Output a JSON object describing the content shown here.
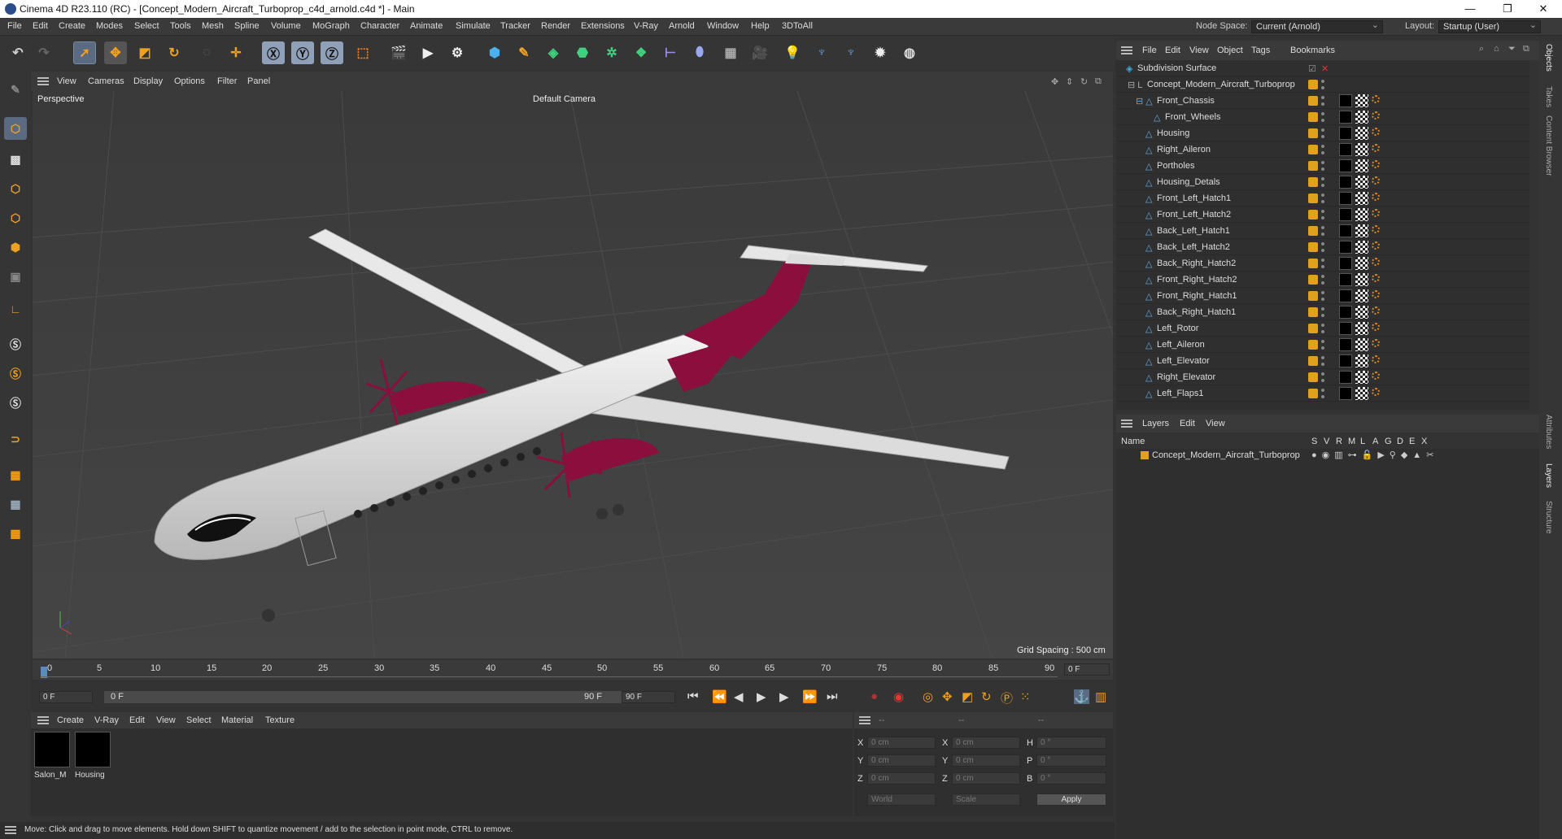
{
  "window": {
    "title": "Cinema 4D R23.110 (RC) - [Concept_Modern_Aircraft_Turboprop_c4d_arnold.c4d *] - Main",
    "controls": [
      "—",
      "❐",
      "✕"
    ]
  },
  "menubar": {
    "items": [
      "File",
      "Edit",
      "Create",
      "Modes",
      "Select",
      "Tools",
      "Mesh",
      "Spline",
      "Volume",
      "MoGraph",
      "Character",
      "Animate",
      "Simulate",
      "Tracker",
      "Render",
      "Extensions",
      "V-Ray",
      "Arnold",
      "Window",
      "Help",
      "3DToAll"
    ],
    "node_space_label": "Node Space:",
    "node_space_value": "Current (Arnold)",
    "layout_label": "Layout:",
    "layout_value": "Startup (User)"
  },
  "viewport": {
    "menu": [
      "View",
      "Cameras",
      "Display",
      "Options",
      "Filter",
      "Panel"
    ],
    "label": "Perspective",
    "camera": "Default Camera",
    "grid_spacing": "Grid Spacing : 500 cm"
  },
  "timeline": {
    "ticks": [
      "0",
      "5",
      "10",
      "15",
      "20",
      "25",
      "30",
      "35",
      "40",
      "45",
      "50",
      "55",
      "60",
      "65",
      "70",
      "75",
      "80",
      "85",
      "90"
    ],
    "current_frame": "0 F",
    "start_field": "0 F",
    "range_start": "0 F",
    "range_end": "90 F",
    "end_field": "90 F"
  },
  "materials": {
    "menu": [
      "Create",
      "V-Ray",
      "Edit",
      "View",
      "Select",
      "Material",
      "Texture"
    ],
    "items": [
      "Salon_M",
      "Housing"
    ]
  },
  "coordinates": {
    "header": [
      "--",
      "--",
      "--"
    ],
    "rows": [
      {
        "a": "X",
        "v1": "0 cm",
        "b": "X",
        "v2": "0 cm",
        "c": "H",
        "v3": "0 °"
      },
      {
        "a": "Y",
        "v1": "0 cm",
        "b": "Y",
        "v2": "0 cm",
        "c": "P",
        "v3": "0 °"
      },
      {
        "a": "Z",
        "v1": "0 cm",
        "b": "Z",
        "v2": "0 cm",
        "c": "B",
        "v3": "0 °"
      }
    ],
    "mode1": "World",
    "mode2": "Scale",
    "apply": "Apply"
  },
  "status": "Move: Click and drag to move elements. Hold down SHIFT to quantize movement / add to the selection in point mode, CTRL to remove.",
  "objects": {
    "menu": [
      "File",
      "Edit",
      "View",
      "Object",
      "Tags",
      "Bookmarks"
    ],
    "items": [
      {
        "name": "Subdivision Surface",
        "indent": 0
      },
      {
        "name": "Concept_Modern_Aircraft_Turboprop",
        "indent": 1
      },
      {
        "name": "Front_Chassis",
        "indent": 2
      },
      {
        "name": "Front_Wheels",
        "indent": 3
      },
      {
        "name": "Housing",
        "indent": 2
      },
      {
        "name": "Right_Aileron",
        "indent": 2
      },
      {
        "name": "Portholes",
        "indent": 2
      },
      {
        "name": "Housing_Detals",
        "indent": 2
      },
      {
        "name": "Front_Left_Hatch1",
        "indent": 2
      },
      {
        "name": "Front_Left_Hatch2",
        "indent": 2
      },
      {
        "name": "Back_Left_Hatch1",
        "indent": 2
      },
      {
        "name": "Back_Left_Hatch2",
        "indent": 2
      },
      {
        "name": "Back_Right_Hatch2",
        "indent": 2
      },
      {
        "name": "Front_Right_Hatch2",
        "indent": 2
      },
      {
        "name": "Front_Right_Hatch1",
        "indent": 2
      },
      {
        "name": "Back_Right_Hatch1",
        "indent": 2
      },
      {
        "name": "Left_Rotor",
        "indent": 2
      },
      {
        "name": "Left_Aileron",
        "indent": 2
      },
      {
        "name": "Left_Elevator",
        "indent": 2
      },
      {
        "name": "Right_Elevator",
        "indent": 2
      },
      {
        "name": "Left_Flaps1",
        "indent": 2
      }
    ]
  },
  "layers": {
    "menu": [
      "Layers",
      "Edit",
      "View"
    ],
    "col_name": "Name",
    "cols": [
      "S",
      "V",
      "R",
      "M",
      "L",
      "A",
      "G",
      "D",
      "E",
      "X"
    ],
    "items": [
      "Concept_Modern_Aircraft_Turboprop"
    ]
  },
  "sidetabs": [
    "Objects",
    "Takes",
    "Content Browser",
    "Attributes",
    "Layers",
    "Structure"
  ],
  "colors": {
    "accent": "#e0a21d",
    "fuselage_trim": "#8a0f3c",
    "selection": "#5a6a80"
  }
}
